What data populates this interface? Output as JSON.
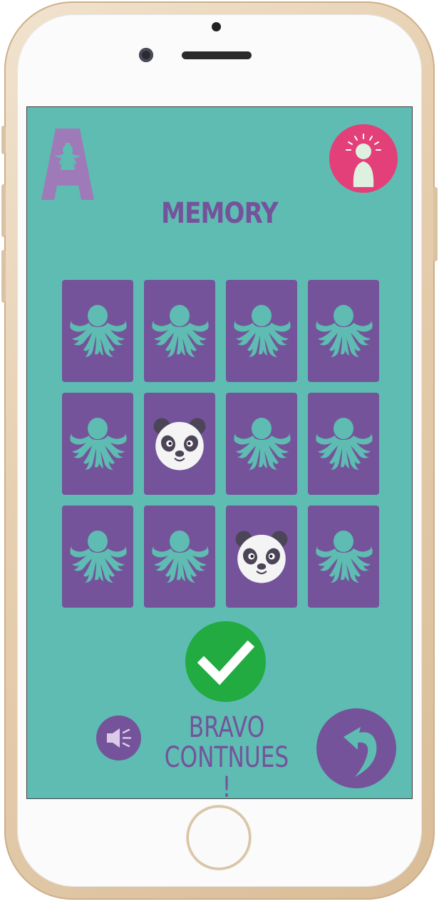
{
  "app": {
    "title": "MEMORY",
    "logo_icon": "letter-a-octopus-logo",
    "help_icon": "idea-person-icon"
  },
  "board": {
    "rows": 3,
    "cols": 4,
    "cards": [
      {
        "face": "octopus-back"
      },
      {
        "face": "octopus-back"
      },
      {
        "face": "octopus-back"
      },
      {
        "face": "octopus-back"
      },
      {
        "face": "octopus-back"
      },
      {
        "face": "panda"
      },
      {
        "face": "octopus-back"
      },
      {
        "face": "octopus-back"
      },
      {
        "face": "octopus-back"
      },
      {
        "face": "octopus-back"
      },
      {
        "face": "panda"
      },
      {
        "face": "octopus-back"
      }
    ]
  },
  "feedback": {
    "line1": "BRAVO",
    "line2": "CONTNUES !",
    "check_icon": "checkmark-icon"
  },
  "controls": {
    "sound_icon": "speaker-icon",
    "back_icon": "curved-back-arrow-icon"
  },
  "colors": {
    "background": "#5ebcb2",
    "card": "#74539a",
    "accent_pink": "#e33f78",
    "success_green": "#21ab40"
  }
}
